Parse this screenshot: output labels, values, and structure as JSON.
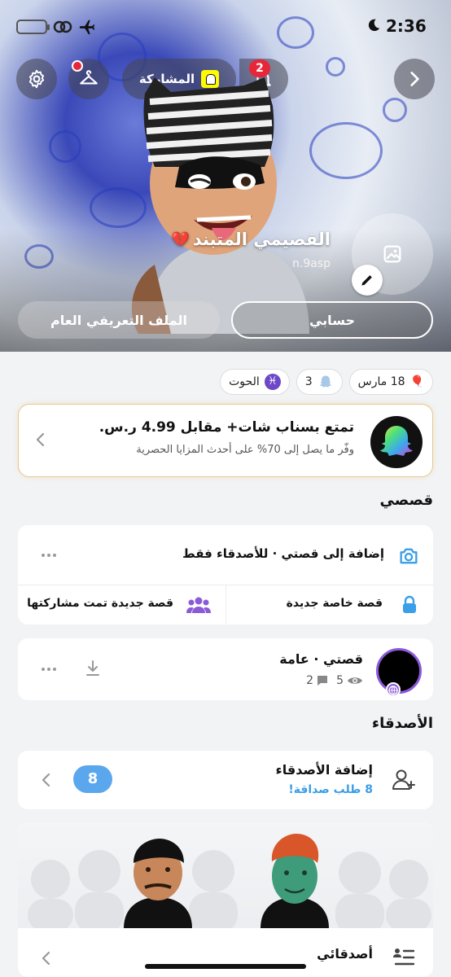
{
  "status_bar": {
    "time": "2:36"
  },
  "header": {
    "share_label": "المشاركة",
    "notification_count": "2"
  },
  "profile": {
    "display_name": "القصيمي المتبند",
    "username": "n.9asp",
    "account_button": "حسابي",
    "public_profile_button": "الملف التعريفي العام"
  },
  "chips": {
    "birthday": "18 مارس",
    "snap_score": "3",
    "zodiac": "الحوت"
  },
  "promo": {
    "title": "تمتع بسناب شات+ مقابل 4.99 ر.س.",
    "subtitle": "وفّر ما يصل إلى 70% على أحدث المزايا الحصرية"
  },
  "stories": {
    "section_title": "قصصي",
    "add_story_label": "إضافة إلى قصتي · للأصدقاء فقط",
    "new_private_story": "قصة خاصة جديدة",
    "new_shared_story": "قصة جديدة تمت مشاركتها",
    "my_story_title": "قصتي · عامة",
    "views": "5",
    "replies": "2"
  },
  "friends": {
    "section_title": "الأصدقاء",
    "add_friends_title": "إضافة الأصدقاء",
    "friend_requests": "8 طلب صداقة!",
    "request_count": "8",
    "my_friends_label": "أصدقائي"
  },
  "colors": {
    "accent_blue": "#5aa7ee",
    "badge_red": "#e8263a",
    "promo_border": "#e7c88d",
    "snap_yellow": "#fffc00"
  }
}
